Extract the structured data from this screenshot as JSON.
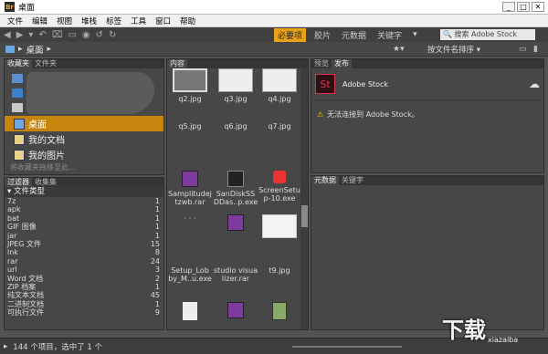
{
  "window": {
    "title": "桌面",
    "app_badge": "Br",
    "minimize": "_",
    "maximize": "□",
    "close": "✕"
  },
  "menu": [
    "文件",
    "编辑",
    "视图",
    "堆栈",
    "标签",
    "工具",
    "窗口",
    "帮助"
  ],
  "toolbar": {
    "tabs": [
      "必要项",
      "胶片",
      "元数据",
      "关键字"
    ],
    "active_tab": "必要项",
    "search_placeholder": "🔍 搜索 Adobe Stock"
  },
  "pathbar": {
    "location": "桌面",
    "sort_label": "按文件名排序 ▾"
  },
  "left_panel": {
    "tabs": [
      "收藏夹",
      "文件夹"
    ],
    "active_tab": "收藏夹",
    "items": [
      "桌面",
      "我的文档",
      "我的图片"
    ],
    "selected": "桌面",
    "drop_hint": "将收藏夹拖移至此..."
  },
  "filter_panel": {
    "tabs": [
      "过滤器",
      "收集集"
    ],
    "active_tab": "过滤器",
    "header": "▾ 文件类型",
    "rows": [
      {
        "label": "7z",
        "count": "1"
      },
      {
        "label": "apk",
        "count": "1"
      },
      {
        "label": "bat",
        "count": "1"
      },
      {
        "label": "GIF 图像",
        "count": "1"
      },
      {
        "label": "jar",
        "count": "1"
      },
      {
        "label": "JPEG 文件",
        "count": "15"
      },
      {
        "label": "lnk",
        "count": "8"
      },
      {
        "label": "rar",
        "count": "24"
      },
      {
        "label": "url",
        "count": "3"
      },
      {
        "label": "Word 文档",
        "count": "2"
      },
      {
        "label": "ZIP 档案",
        "count": "1"
      },
      {
        "label": "纯文本文档",
        "count": "45"
      },
      {
        "label": "二进制文档",
        "count": "1"
      },
      {
        "label": "可执行文件",
        "count": "9"
      }
    ]
  },
  "content_panel": {
    "tab": "内容",
    "files": [
      {
        "name": "q2.jpg",
        "kind": "photo"
      },
      {
        "name": "q3.jpg",
        "kind": "screen"
      },
      {
        "name": "q4.jpg",
        "kind": "screen"
      },
      {
        "name": "q5.jpg",
        "kind": "none"
      },
      {
        "name": "q6.jpg",
        "kind": "none"
      },
      {
        "name": "q7.jpg",
        "kind": "none"
      },
      {
        "name": "Samplitudej tzwb.rar",
        "kind": "rar"
      },
      {
        "name": "SanDiskSS DDas..p.exe",
        "kind": "ssd"
      },
      {
        "name": "ScreenSetu p-10.exe",
        "kind": "red"
      },
      {
        "name": "",
        "kind": "dots"
      },
      {
        "name": "",
        "kind": "rar"
      },
      {
        "name": "",
        "kind": "doc"
      },
      {
        "name": "Setup_Lob by_M..u.exe",
        "kind": "none"
      },
      {
        "name": "studio visua lizer.rar",
        "kind": "none"
      },
      {
        "name": "t9.jpg",
        "kind": "none"
      },
      {
        "name": "",
        "kind": "blank"
      },
      {
        "name": "",
        "kind": "rar"
      },
      {
        "name": "",
        "kind": "apk"
      }
    ]
  },
  "preview_panel": {
    "tabs": [
      "预览",
      "发布"
    ],
    "active_tab": "发布",
    "service": "Adobe Stock",
    "service_icon": "St",
    "warning": "无法连接到 Adobe Stock。"
  },
  "meta_panel": {
    "tabs": [
      "元数据",
      "关键字"
    ],
    "active_tab": "元数据"
  },
  "status": {
    "text": "144 个项目，选中了 1 个"
  },
  "watermark": {
    "text": "下载",
    "sub": "xiazaiba"
  },
  "colors": {
    "accent": "#e8a21a",
    "stock": "#e0364d"
  }
}
